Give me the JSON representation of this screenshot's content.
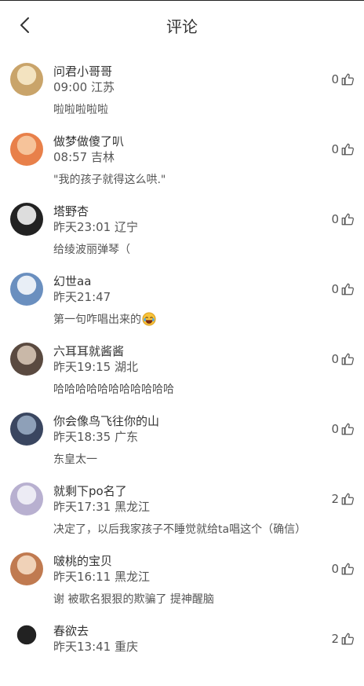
{
  "header": {
    "title": "评论"
  },
  "comments": [
    {
      "name": "问君小哥哥",
      "meta": "09:00 江苏",
      "content": "啦啦啦啦啦",
      "likes": "0",
      "avatar_colors": [
        "#c9a46a",
        "#f3e3c0"
      ]
    },
    {
      "name": "做梦做傻了叭",
      "meta": "08:57 吉林",
      "content": "\"我的孩子就得这么哄.\"",
      "likes": "0",
      "avatar_colors": [
        "#e8804a",
        "#f6c39a"
      ]
    },
    {
      "name": "塔野杏",
      "meta": "昨天23:01 辽宁",
      "content": "给绫波丽弹琴（",
      "likes": "0",
      "avatar_colors": [
        "#222222",
        "#dddddd"
      ]
    },
    {
      "name": "幻世aa",
      "meta": "昨天21:47",
      "content": "第一句咋唱出来的",
      "likes": "0",
      "avatar_colors": [
        "#6a8fbf",
        "#e8eef6"
      ],
      "emoji": "laughing-tears-emoji"
    },
    {
      "name": "六耳耳就酱酱",
      "meta": "昨天19:15 湖北",
      "content": "哈哈哈哈哈哈哈哈哈哈哈",
      "likes": "0",
      "avatar_colors": [
        "#5a4a40",
        "#c9b8a8"
      ]
    },
    {
      "name": "你会像鸟飞往你的山",
      "meta": "昨天18:35 广东",
      "content": "东皇太一",
      "likes": "0",
      "avatar_colors": [
        "#3a4660",
        "#8ea0b8"
      ]
    },
    {
      "name": "就剩下po名了",
      "meta": "昨天17:31 黑龙江",
      "content": "决定了，以后我家孩子不睡觉就给ta唱这个（确信）",
      "likes": "2",
      "avatar_colors": [
        "#b8b0d0",
        "#ecebf4"
      ]
    },
    {
      "name": "啵桃的宝贝",
      "meta": "昨天16:11 黑龙江",
      "content": "谢 被歌名狠狠的欺骗了 提神醒脑",
      "likes": "0",
      "avatar_colors": [
        "#c07a50",
        "#f0d2b8"
      ]
    },
    {
      "name": "春欲去",
      "meta": "昨天13:41 重庆",
      "content": "",
      "likes": "2",
      "avatar_colors": [
        "#ffffff",
        "#222222"
      ]
    }
  ]
}
